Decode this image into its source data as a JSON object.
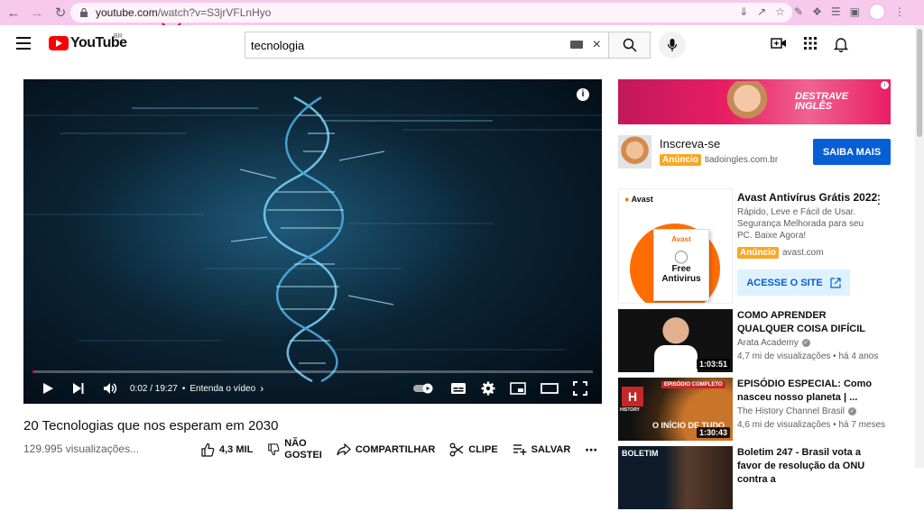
{
  "browser": {
    "url_domain": "youtube.com",
    "url_path": "/watch?v=S3jrVFLnHyo"
  },
  "header": {
    "logo_text": "YouTube",
    "region": "BR",
    "search_value": "tecnologia"
  },
  "player": {
    "time": "0:02 / 19:27",
    "chapter": "Entenda o vídeo",
    "progress": 0.002
  },
  "video": {
    "title": "20 Tecnologias que nos esperam em 2030",
    "views": "129.995 visualizações...",
    "like_count": "4,3 MIL",
    "dislike_label_1": "NÃO",
    "dislike_label_2": "GOSTEI",
    "share_label": "COMPARTILHAR",
    "clip_label": "CLIPE",
    "save_label": "SALVAR"
  },
  "banner_ad": {
    "text_1": "DESTRAVE",
    "text_2": "INGLÊS"
  },
  "subscribe_ad": {
    "title": "Inscreva-se",
    "badge": "Anúncio",
    "domain": "tiadoingles.com.br",
    "button": "SAIBA MAIS"
  },
  "avast_ad": {
    "brand": "Avast",
    "box_brand": "Avast",
    "box_line1": "Free",
    "box_line2": "Antivirus",
    "title": "Avast Antivírus Grátis 2022",
    "description": "Rápido, Leve e Fácil de Usar. Segurança Melhorada para seu PC. Baixe Agora!",
    "badge": "Anúncio",
    "domain": "avast.com",
    "button": "ACESSE O SITE"
  },
  "recommendations": [
    {
      "title": "COMO APRENDER QUALQUER COISA DIFÍCIL",
      "channel": "Arata Academy",
      "meta": "4,7 mi de visualizações • há 4 anos",
      "duration": "1:03:51"
    },
    {
      "title": "EPISÓDIO ESPECIAL: Como nasceu nosso planeta | ...",
      "channel": "The History Channel Brasil",
      "meta": "4,6 mi de visualizações • há 7 meses",
      "duration": "1:30:43",
      "thumb_text_top": "EPISÓDIO COMPLETO",
      "thumb_text_bottom": "O INÍCIO DE TUDO",
      "thumb_logo": "HISTORY"
    },
    {
      "title": "Boletim 247 - Brasil vota a favor de resolução da ONU contra a",
      "thumb_text": "BOLETIM"
    }
  ],
  "colors": {
    "chrome_bar": "#f7c9ec",
    "youtube_red": "#ff0000",
    "blue_button": "#065fd4",
    "ad_badge": "#f9a825"
  }
}
